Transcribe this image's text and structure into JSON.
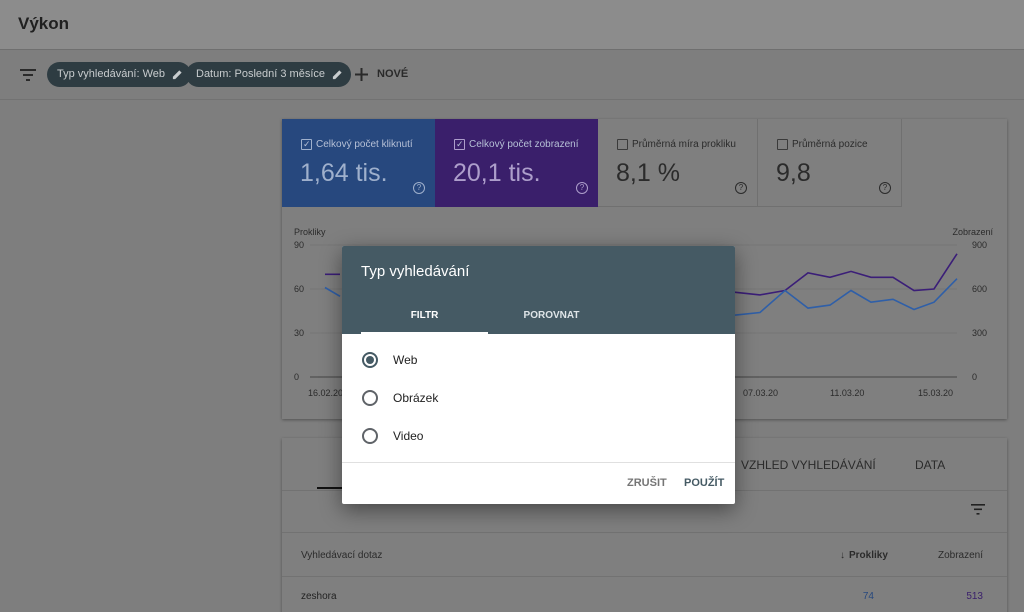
{
  "header": {
    "title": "Výkon"
  },
  "filterbar": {
    "chips": [
      {
        "label": "Typ vyhledávání: Web"
      },
      {
        "label": "Datum: Poslední 3 měsíce"
      }
    ],
    "new_label": "NOVÉ"
  },
  "metrics": [
    {
      "label": "Celkový počet kliknutí",
      "value": "1,64 tis.",
      "checked": true,
      "color": "#4285f4"
    },
    {
      "label": "Celkový počet zobrazení",
      "value": "20,1 tis.",
      "checked": true,
      "color": "#5e35b1"
    },
    {
      "label": "Průměrná míra prokliku",
      "value": "8,1 %",
      "checked": false
    },
    {
      "label": "Průměrná pozice",
      "value": "9,8",
      "checked": false
    }
  ],
  "help_glyph": "?",
  "check_glyph": "✓",
  "chart_data": {
    "type": "line",
    "left_axis_label": "Prokliky",
    "right_axis_label": "Zobrazení",
    "left_ticks": [
      "90",
      "60",
      "30",
      "0"
    ],
    "right_ticks": [
      "900",
      "600",
      "300",
      "0"
    ],
    "ylim_left": [
      0,
      90
    ],
    "ylim_right": [
      0,
      900
    ],
    "x_tick_labels": [
      "16.02.20",
      "07.03.20",
      "11.03.20",
      "15.03.20"
    ],
    "visible_left": {
      "clicks": [
        61,
        55
      ],
      "impressions": [
        700,
        700
      ]
    },
    "visible_right": {
      "clicks": [
        42,
        44,
        59,
        47,
        49,
        59,
        51,
        53,
        46,
        51,
        67
      ],
      "impressions": [
        580,
        560,
        590,
        710,
        680,
        720,
        680,
        680,
        590,
        600,
        840
      ]
    },
    "series": [
      {
        "name": "Celkový počet kliknutí",
        "color": "#2f5fa8"
      },
      {
        "name": "Celkový počet zobrazení",
        "color": "#3b1e78"
      }
    ]
  },
  "table": {
    "tabs": [
      "VZHLED VYHLEDÁVÁNÍ",
      "DATA"
    ],
    "columns": {
      "query": "Vyhledávací dotaz",
      "clicks": "Prokliky",
      "impressions": "Zobrazení"
    },
    "sort_arrow": "↓",
    "rows": [
      {
        "query": "zeshora",
        "clicks": "74",
        "impressions": "513"
      }
    ]
  },
  "dialog": {
    "title": "Typ vyhledávání",
    "tabs": [
      "FILTR",
      "POROVNAT"
    ],
    "options": [
      {
        "label": "Web",
        "selected": true
      },
      {
        "label": "Obrázek",
        "selected": false
      },
      {
        "label": "Video",
        "selected": false
      }
    ],
    "cancel_label": "ZRUŠIT",
    "apply_label": "POUŽÍT"
  }
}
